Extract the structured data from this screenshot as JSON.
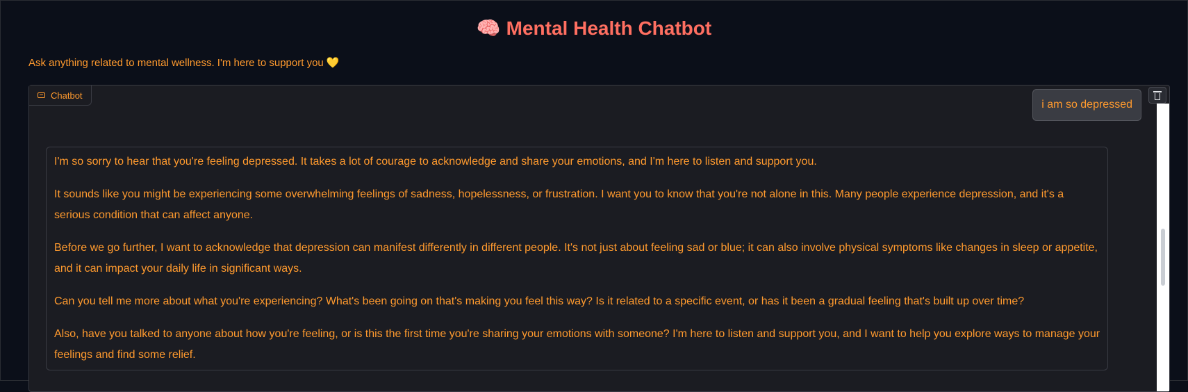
{
  "header": {
    "title": "Mental Health Chatbot",
    "title_emoji": "🧠",
    "subtitle": "Ask anything related to mental wellness. I'm here to support you",
    "subtitle_emoji": "💛"
  },
  "chatbot": {
    "label": "Chatbot",
    "messages": {
      "user": "i am so depressed",
      "bot": [
        "I'm so sorry to hear that you're feeling depressed. It takes a lot of courage to acknowledge and share your emotions, and I'm here to listen and support you.",
        "It sounds like you might be experiencing some overwhelming feelings of sadness, hopelessness, or frustration. I want you to know that you're not alone in this. Many people experience depression, and it's a serious condition that can affect anyone.",
        "Before we go further, I want to acknowledge that depression can manifest differently in different people. It's not just about feeling sad or blue; it can also involve physical symptoms like changes in sleep or appetite, and it can impact your daily life in significant ways.",
        "Can you tell me more about what you're experiencing? What's been going on that's making you feel this way? Is it related to a specific event, or has it been a gradual feeling that's built up over time?",
        "Also, have you talked to anyone about how you're feeling, or is this the first time you're sharing your emotions with someone? I'm here to listen and support you, and I want to help you explore ways to manage your feelings and find some relief."
      ]
    }
  },
  "colors": {
    "title": "#ff6f61",
    "text_accent": "#ff9a2e",
    "background": "#0b0f19",
    "panel": "#1b1c22"
  }
}
